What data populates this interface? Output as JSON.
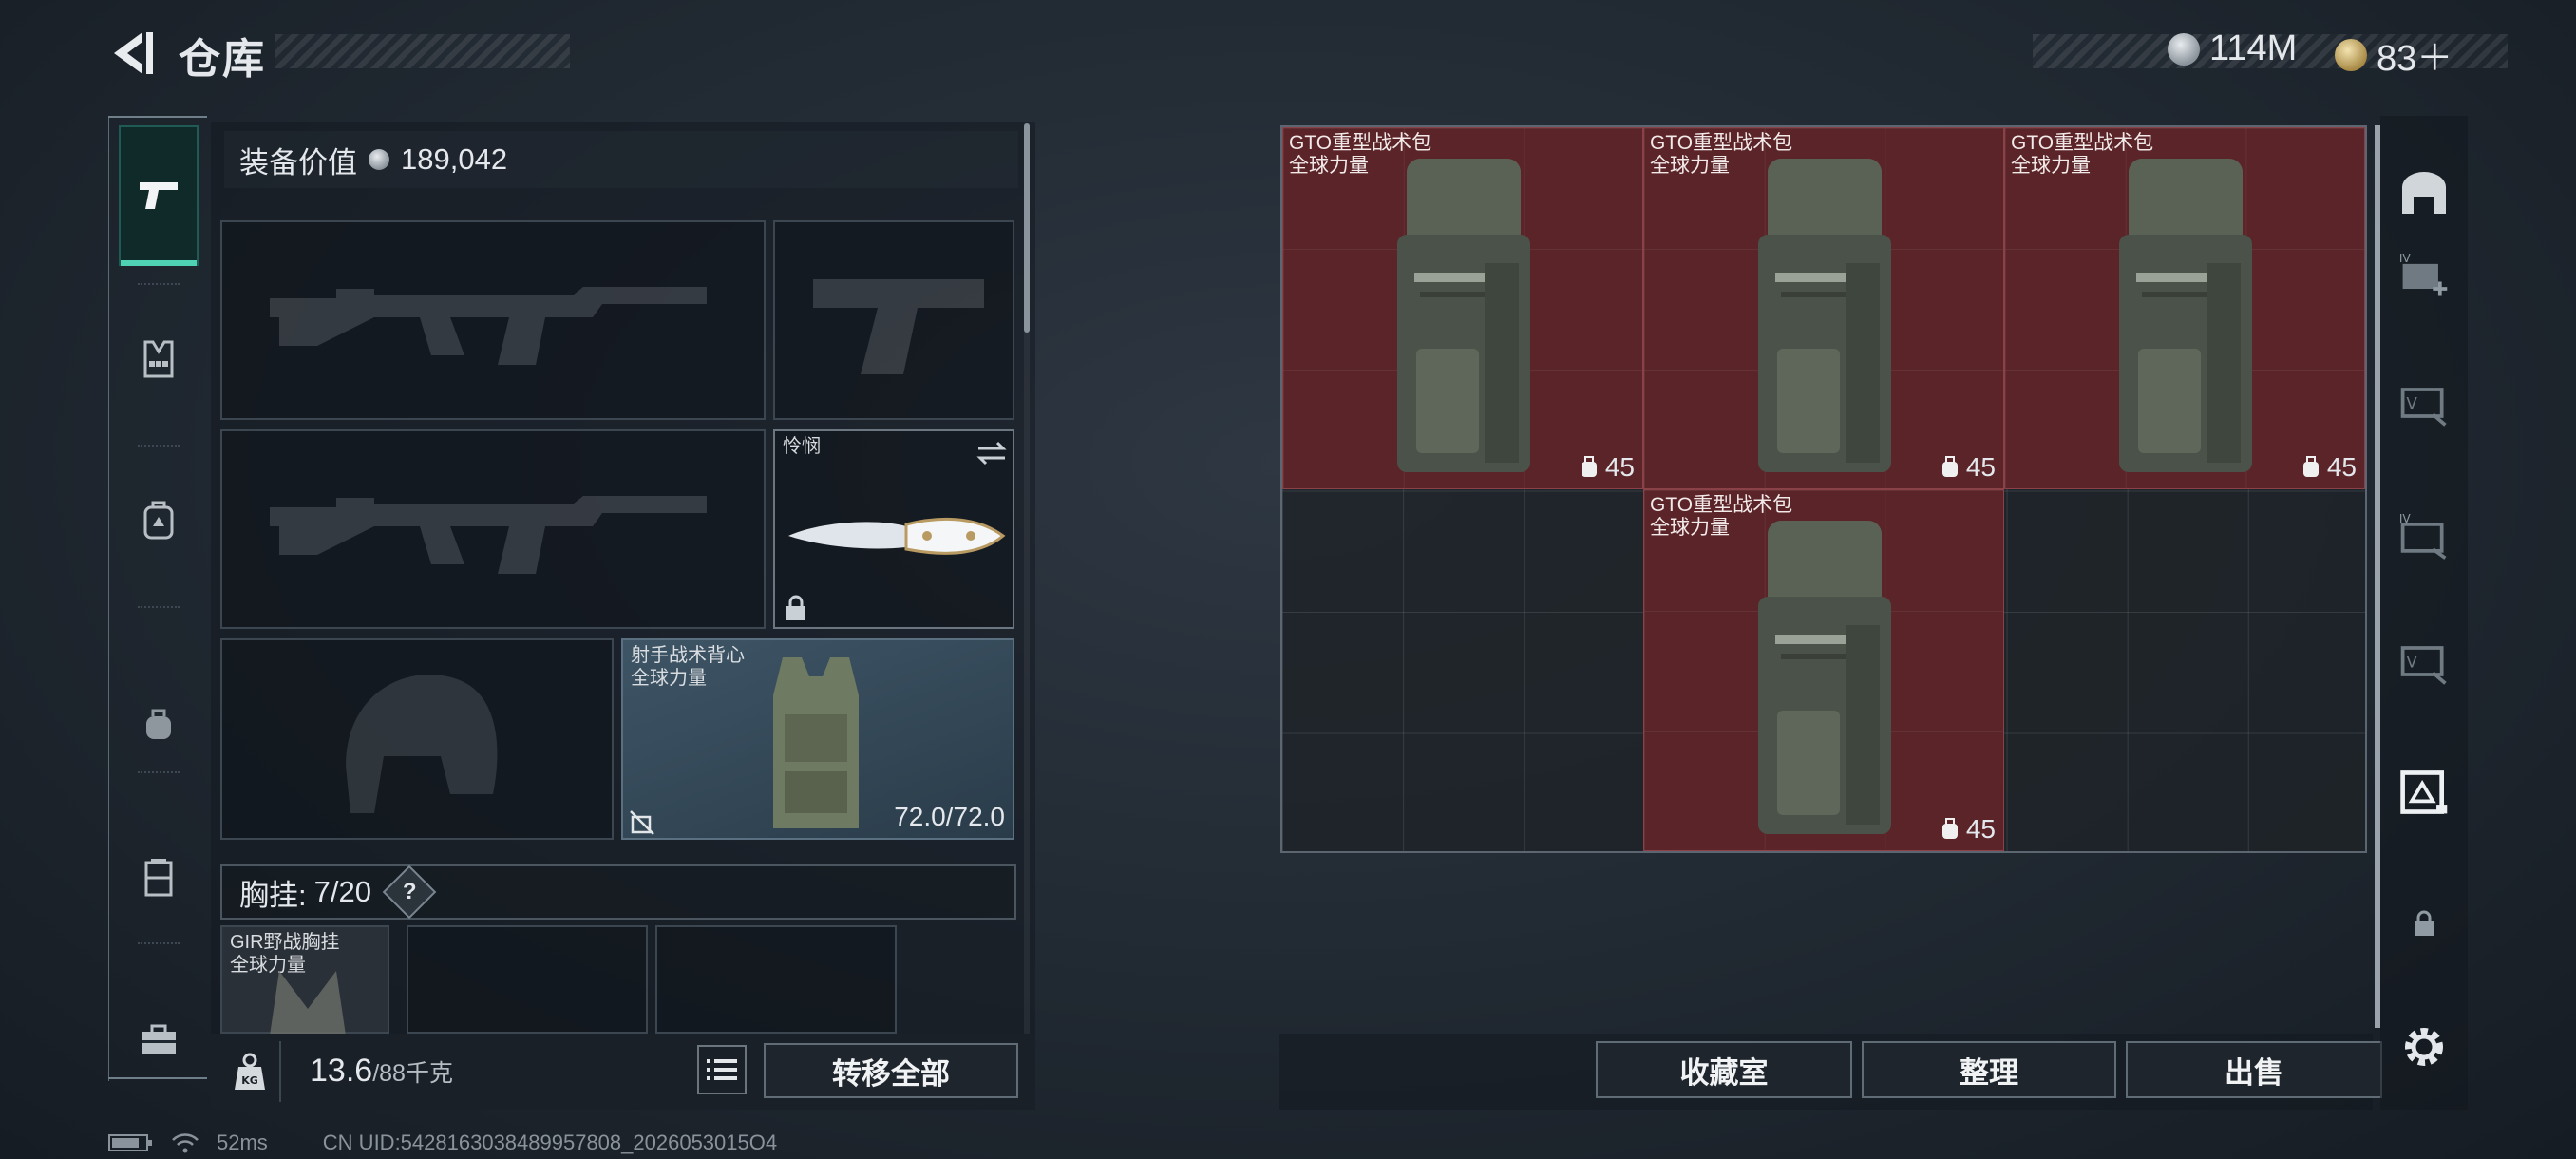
{
  "header": {
    "title": "仓库",
    "currency_silver": "114M",
    "currency_gold": "83＋"
  },
  "equipment": {
    "value_label": "装备价值",
    "value": "189,042",
    "knife_label": "怜悯",
    "vest_name": "射手战术背心",
    "vest_faction": "全球力量",
    "vest_durability": "72.0/72.0",
    "chest_label": "胸挂:",
    "chest_count": "7/20",
    "chest_help": "?",
    "rig_name": "GIR野战胸挂",
    "rig_faction": "全球力量"
  },
  "bottom_left": {
    "weight": "13.6",
    "weight_max": "/88千克",
    "transfer_all": "转移全部"
  },
  "backpack_items": [
    {
      "name": "GTO重型战术包",
      "faction": "全球力量",
      "count": "45"
    },
    {
      "name": "GTO重型战术包",
      "faction": "全球力量",
      "count": "45"
    },
    {
      "name": "GTO重型战术包",
      "faction": "全球力量",
      "count": "45"
    },
    {
      "name": "GTO重型战术包",
      "faction": "全球力量",
      "count": "45"
    }
  ],
  "actions": {
    "collection": "收藏室",
    "organize": "整理",
    "sell": "出售"
  },
  "status": {
    "ping": "52ms",
    "uid": "CN UID:5428163038489957808_2026053015O4"
  },
  "colors": {
    "accent": "#4fd1b4",
    "item_bg": "#5a2428",
    "background": "#202831"
  },
  "icons": [
    "back-arrow-icon",
    "pistol-icon",
    "chest-rig-icon",
    "backpack-icon",
    "helmet-icon",
    "container-icon",
    "toolbox-icon",
    "safebox-icon",
    "lock-icon",
    "swap-icon",
    "kg-icon",
    "list-icon",
    "gear-icon"
  ]
}
